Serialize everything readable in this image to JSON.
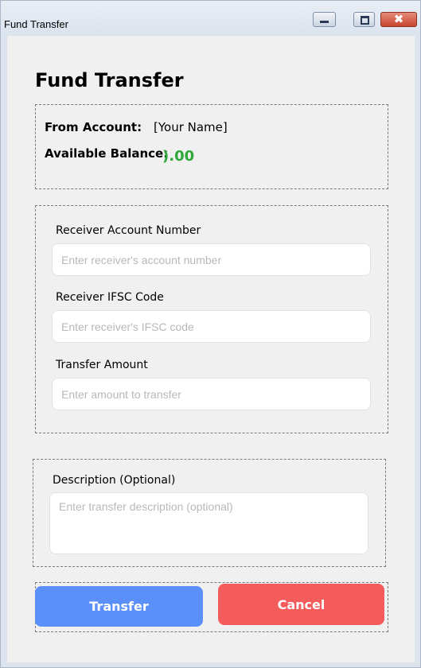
{
  "window": {
    "title": "Fund Transfer",
    "close_glyph": "✖",
    "colors": {
      "frame": "#dde4ed",
      "client": "#f0f0f0",
      "close_button": "#c7452f"
    }
  },
  "page": {
    "title": "Fund Transfer"
  },
  "account_info": {
    "from_label": "From Account:",
    "from_value": "[Your Name]",
    "balance_label": "Available Balance:",
    "balance_value": ").00",
    "balance_color": "#2fa83a"
  },
  "form": {
    "account_number": {
      "label": "Receiver Account Number",
      "value": "",
      "placeholder": "Enter receiver's account number"
    },
    "ifsc": {
      "label": "Receiver IFSC Code",
      "value": "",
      "placeholder": "Enter receiver's IFSC code"
    },
    "amount": {
      "label": "Transfer Amount",
      "value": "",
      "placeholder": "Enter amount to transfer"
    },
    "description": {
      "label": "Description (Optional)",
      "value": "",
      "placeholder": "Enter transfer description (optional)"
    }
  },
  "actions": {
    "transfer_label": "Transfer",
    "cancel_label": "Cancel",
    "transfer_color": "#5b8ff9",
    "cancel_color": "#f45c5c"
  },
  "icons": [
    "minimize-icon",
    "maximize-icon",
    "close-icon"
  ]
}
